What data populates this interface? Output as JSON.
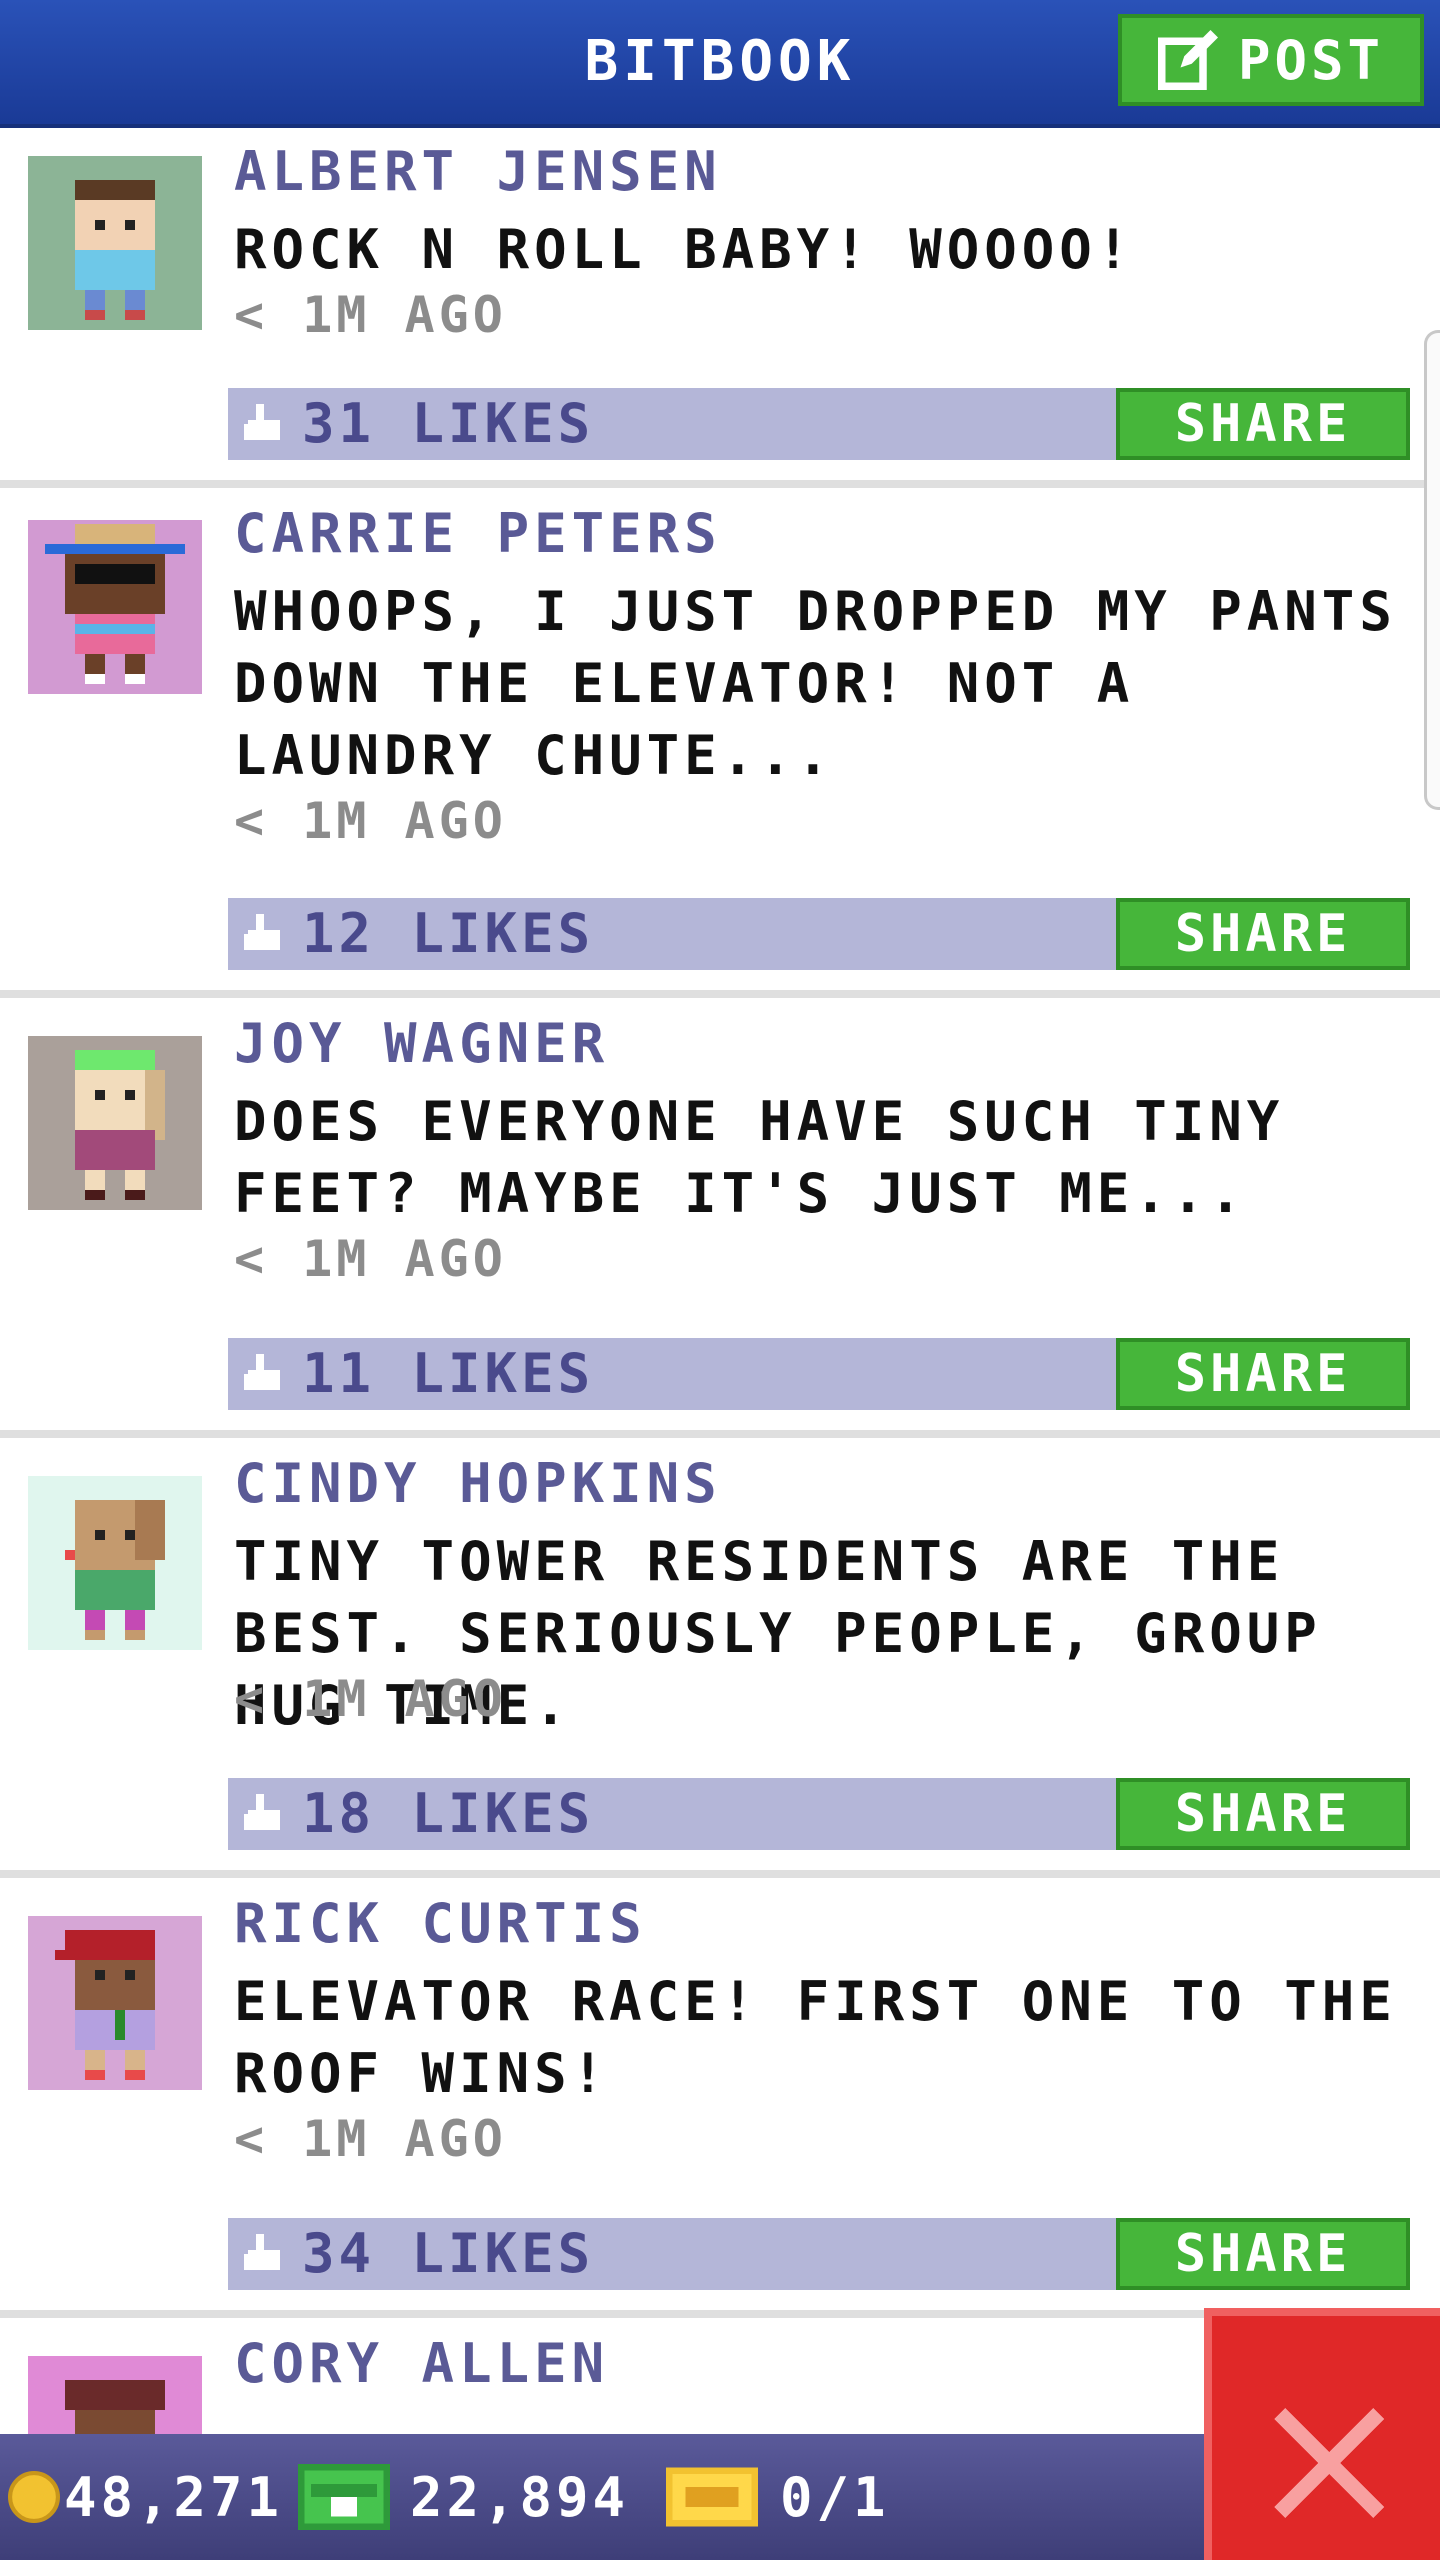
{
  "header": {
    "title": "BITBOOK",
    "post_label": "POST"
  },
  "posts": [
    {
      "name": "ALBERT JENSEN",
      "message": "ROCK N ROLL BABY! WOOOO!",
      "time": "< 1M AGO",
      "likes": "31 LIKES",
      "share": "SHARE",
      "avatar_bg": "#8cb496"
    },
    {
      "name": "CARRIE PETERS",
      "message": "WHOOPS, I JUST DROPPED MY PANTS DOWN THE ELEVATOR! NOT A LAUNDRY CHUTE...",
      "time": "< 1M AGO",
      "likes": "12 LIKES",
      "share": "SHARE",
      "avatar_bg": "#d29ad2"
    },
    {
      "name": "JOY WAGNER",
      "message": "DOES EVERYONE HAVE SUCH TINY FEET? MAYBE IT'S JUST ME...",
      "time": "< 1M AGO",
      "likes": "11 LIKES",
      "share": "SHARE",
      "avatar_bg": "#aaa09a"
    },
    {
      "name": "CINDY HOPKINS",
      "message": "TINY TOWER RESIDENTS ARE THE BEST. SERIOUSLY PEOPLE, GROUP HUG TIME.",
      "time": "< 1M AGO",
      "likes": "18 LIKES",
      "share": "SHARE",
      "avatar_bg": "#e0f6ee"
    },
    {
      "name": "RICK CURTIS",
      "message": "ELEVATOR RACE! FIRST ONE TO THE ROOF WINS!",
      "time": "< 1M AGO",
      "likes": "34 LIKES",
      "share": "SHARE",
      "avatar_bg": "#d6a6d6"
    },
    {
      "name": "CORY ALLEN",
      "message": "",
      "time": "",
      "likes": "",
      "share": "",
      "avatar_bg": "#e08ad6"
    }
  ],
  "status": {
    "coins": "48,271",
    "bux": "22,894",
    "tickets": "0/1"
  },
  "colors": {
    "header": "#2a52b8",
    "green": "#46b63a",
    "like_bar": "#b4b6d8",
    "close": "#e02828"
  },
  "icons": {
    "post": "edit-icon",
    "like": "thumbs-up-icon",
    "close": "close-icon",
    "coin": "coin-icon",
    "bux": "bux-icon",
    "ticket": "ticket-icon"
  }
}
